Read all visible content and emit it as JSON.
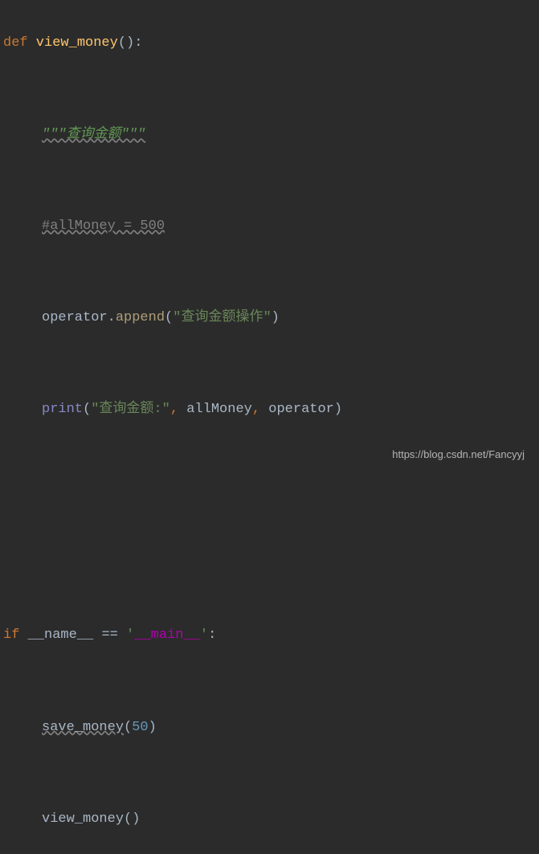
{
  "code": {
    "line1": {
      "def": "def",
      "funcName": " view_money",
      "parens": "()",
      "colon": ":"
    },
    "line2": {
      "docstring": "\"\"\"查询金额\"\"\""
    },
    "line3": {
      "comment": "#allMoney = 500"
    },
    "line4": {
      "identifier": "operator",
      "dot": ".",
      "method": "append",
      "openParen": "(",
      "string": "\"查询金额操作\"",
      "closeParen": ")"
    },
    "line5": {
      "builtin": "print",
      "openParen": "(",
      "string": "\"查询金额:\"",
      "comma1": ",",
      "var1": " allMoney",
      "comma2": ",",
      "var2": " operator",
      "closeParen": ")"
    },
    "line6": {
      "if": "if",
      "name": " __name__ ",
      "eq": "== ",
      "quote1": "'",
      "main": "__main__",
      "quote2": "'",
      "colon": ":"
    },
    "line7": {
      "call": "save_money",
      "openParen": "(",
      "number": "50",
      "closeParen": ")"
    },
    "line8": {
      "call": "view_money",
      "parens": "()"
    }
  },
  "watermark": "https://blog.csdn.net/Fancyyj"
}
